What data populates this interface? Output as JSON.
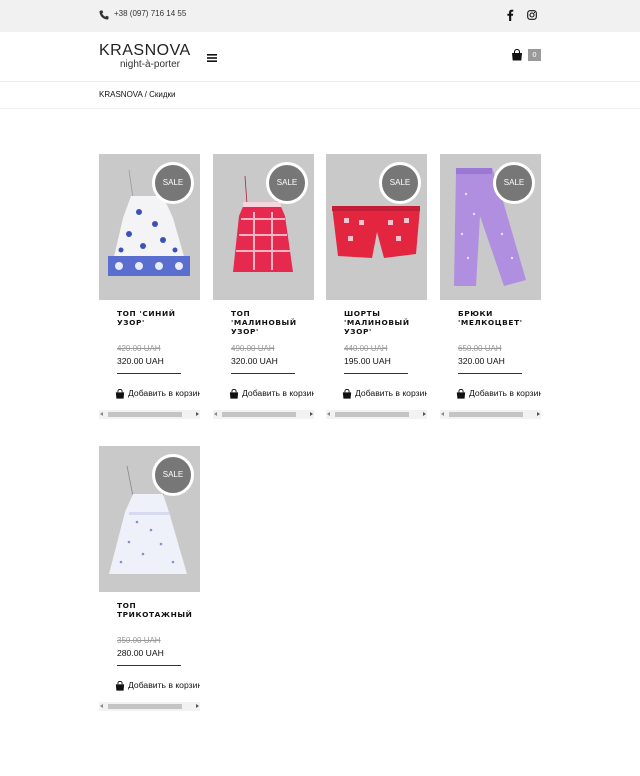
{
  "topbar": {
    "phone": "+38 (097) 716 14 55",
    "icons": [
      "phone-icon",
      "facebook-icon",
      "instagram-icon"
    ]
  },
  "header": {
    "brand": "KRASNOVA",
    "tagline": "night-à-porter",
    "cart_count": "0",
    "icons": [
      "menu-icon",
      "cart-icon"
    ]
  },
  "breadcrumb": {
    "home": "KRASNOVA",
    "separator": " / ",
    "current": "Скидки"
  },
  "products": [
    {
      "name": "ТОП 'СИНИЙ УЗОР'",
      "old_price": "420.00 UAH",
      "price": "320.00 UAH",
      "badge": "SALE",
      "add_label": "Добавить в корзину"
    },
    {
      "name": "ТОП 'МАЛИНОВЫЙ УЗОР'",
      "old_price": "490.00 UAH",
      "price": "320.00 UAH",
      "badge": "SALE",
      "add_label": "Добавить в корзину"
    },
    {
      "name": "ШОРТЫ 'МАЛИНОВЫЙ УЗОР'",
      "old_price": "440.00 UAH",
      "price": "195.00 UAH",
      "badge": "SALE",
      "add_label": "Добавить в корзину"
    },
    {
      "name": "БРЮКИ 'МЕЛКОЦВЕТ'",
      "old_price": "650.00 UAH",
      "price": "320.00 UAH",
      "badge": "SALE",
      "add_label": "Добавить в корзину"
    },
    {
      "name": "ТОП ТРИКОТАЖНЫЙ",
      "old_price": "350.00 UAH",
      "price": "280.00 UAH",
      "badge": "SALE",
      "add_label": "Добавить в корзину"
    }
  ],
  "colors": {
    "topbar_bg": "#f1f1f1",
    "photo_bg": "#c9c9c9",
    "sale_badge": "#777777"
  }
}
